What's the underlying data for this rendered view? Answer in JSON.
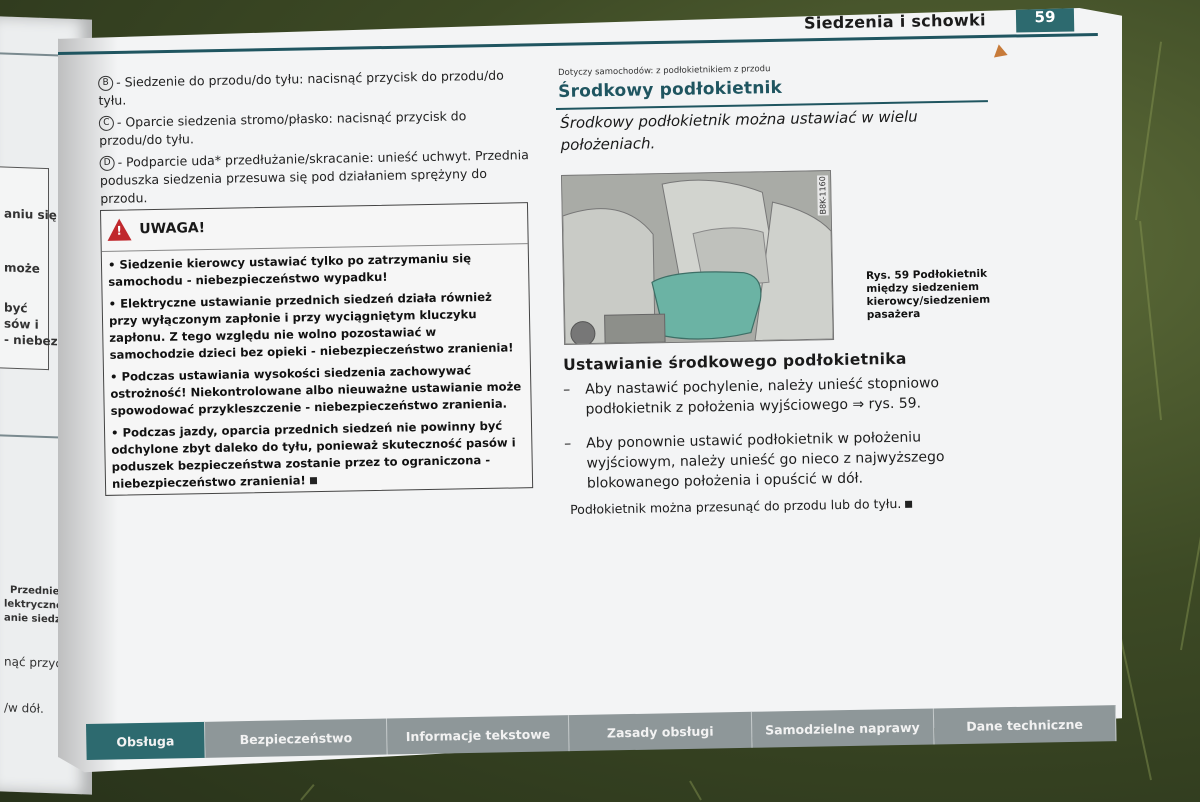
{
  "header": {
    "title": "Siedzenia i schowki",
    "page_number": "59"
  },
  "left_page_fragments": [
    "aniu się",
    "może",
    "być",
    "sów i",
    "- niebez-",
    "Przednie sied-",
    "lektryczne",
    "anie siedzenia",
    "nąć przycisk w",
    "/w dół."
  ],
  "left_column": {
    "items": [
      {
        "marker": "B",
        "text": "- Siedzenie do przodu/do tyłu: nacisnąć przycisk do przodu/do tyłu."
      },
      {
        "marker": "C",
        "text": "- Oparcie siedzenia stromo/płasko: nacisnąć przycisk do przodu/do tyłu."
      },
      {
        "marker": "D",
        "text": "- Podparcie uda* przedłużanie/skracanie: unieść uchwyt. Przednia poduszka siedzenia przesuwa się pod działaniem sprężyny do przodu."
      }
    ],
    "warning": {
      "title": "UWAGA!",
      "bullets": [
        "Siedzenie kierowcy ustawiać tylko po zatrzymaniu się samochodu - niebezpieczeństwo wypadku!",
        "Elektryczne ustawianie przednich siedzeń działa również przy wyłączonym zapłonie i przy wyciągniętym kluczyku zapłonu. Z tego względu nie wolno pozostawiać w samochodzie dzieci bez opieki - niebezpieczeństwo zranienia!",
        "Podczas ustawiania wysokości siedzenia zachowywać ostrożność! Niekontrolowane albo nieuważne ustawianie może spowodować przykleszczenie - niebezpieczeństwo zranienia.",
        "Podczas jazdy, oparcia przednich siedzeń nie powinny być odchylone zbyt daleko do tyłu, ponieważ skuteczność pasów i poduszek bezpieczeństwa zostanie przez to ograniczona - niebezpieczeństwo zranienia!"
      ]
    }
  },
  "right_column": {
    "applies_to": "Dotyczy samochodów: z podłokietnikiem z przodu",
    "section_title": "Środkowy podłokietnik",
    "intro": "Środkowy podłokietnik można ustawiać w wielu położeniach.",
    "figure": {
      "code": "B8K-1160",
      "caption": "Rys. 59  Podłokietnik między siedzeniem kierowcy/siedzeniem pasażera"
    },
    "subsection_title": "Ustawianie środkowego podłokietnika",
    "steps": [
      "Aby nastawić pochylenie, należy unieść stopniowo podłokietnik z położenia wyjściowego ⇒ rys. 59.",
      "Aby ponownie ustawić podłokietnik w położeniu wyjściowym, należy unieść go nieco z najwyższego blokowanego położenia i opuścić w dół."
    ],
    "note": "Podłokietnik można przesunąć do przodu lub do tyłu."
  },
  "tabs": [
    {
      "label": "Obsługa",
      "active": true
    },
    {
      "label": "Bezpieczeństwo",
      "active": false
    },
    {
      "label": "Informacje tekstowe",
      "active": false
    },
    {
      "label": "Zasady obsługi",
      "active": false
    },
    {
      "label": "Samodzielne naprawy",
      "active": false
    },
    {
      "label": "Dane techniczne",
      "active": false
    }
  ],
  "colors": {
    "accent": "#2d6a6f",
    "heading": "#1f5560",
    "warning": "#c0282d",
    "armrest": "#6bb3a4",
    "tab_inactive": "#8e9799"
  }
}
